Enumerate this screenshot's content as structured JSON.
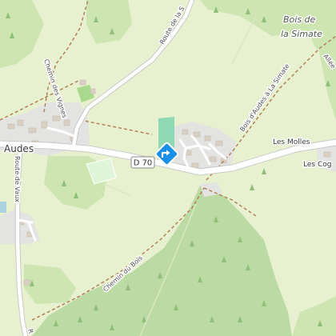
{
  "map": {
    "places": {
      "audes": "Audes",
      "les_molles": "Les Molles",
      "les_cog": "Les Cog",
      "bois_de_la_simate_line1": "Bois de",
      "bois_de_la_simate_line2": "la Simate",
      "allee_partial": "Allée"
    },
    "roads": {
      "route_de_la_s": "Route de la S",
      "chemin_des_vignes": "Chemin des Vignes",
      "route_de_vaux": "Route de Vaux",
      "bois_d_audes_a_la_simate": "Bois d'Audes à La Simate",
      "chemin_du_bois": "Chemin du Bois",
      "d70_shield": "D 70",
      "partial_r": "R"
    },
    "marker": {
      "icon": "directions-diamond-icon",
      "color": "#1a8fe6"
    },
    "colors": {
      "meadow": "#e7f0cf",
      "forest": "#cde5b1",
      "dense_forest": "#b6d6a0",
      "residential": "#e2e2e2",
      "road": "#ffffff",
      "road_casing": "#c8c8c8",
      "path": "#b07a50",
      "water_area": "#7fd6b0",
      "building": "#d9cfc2"
    }
  }
}
